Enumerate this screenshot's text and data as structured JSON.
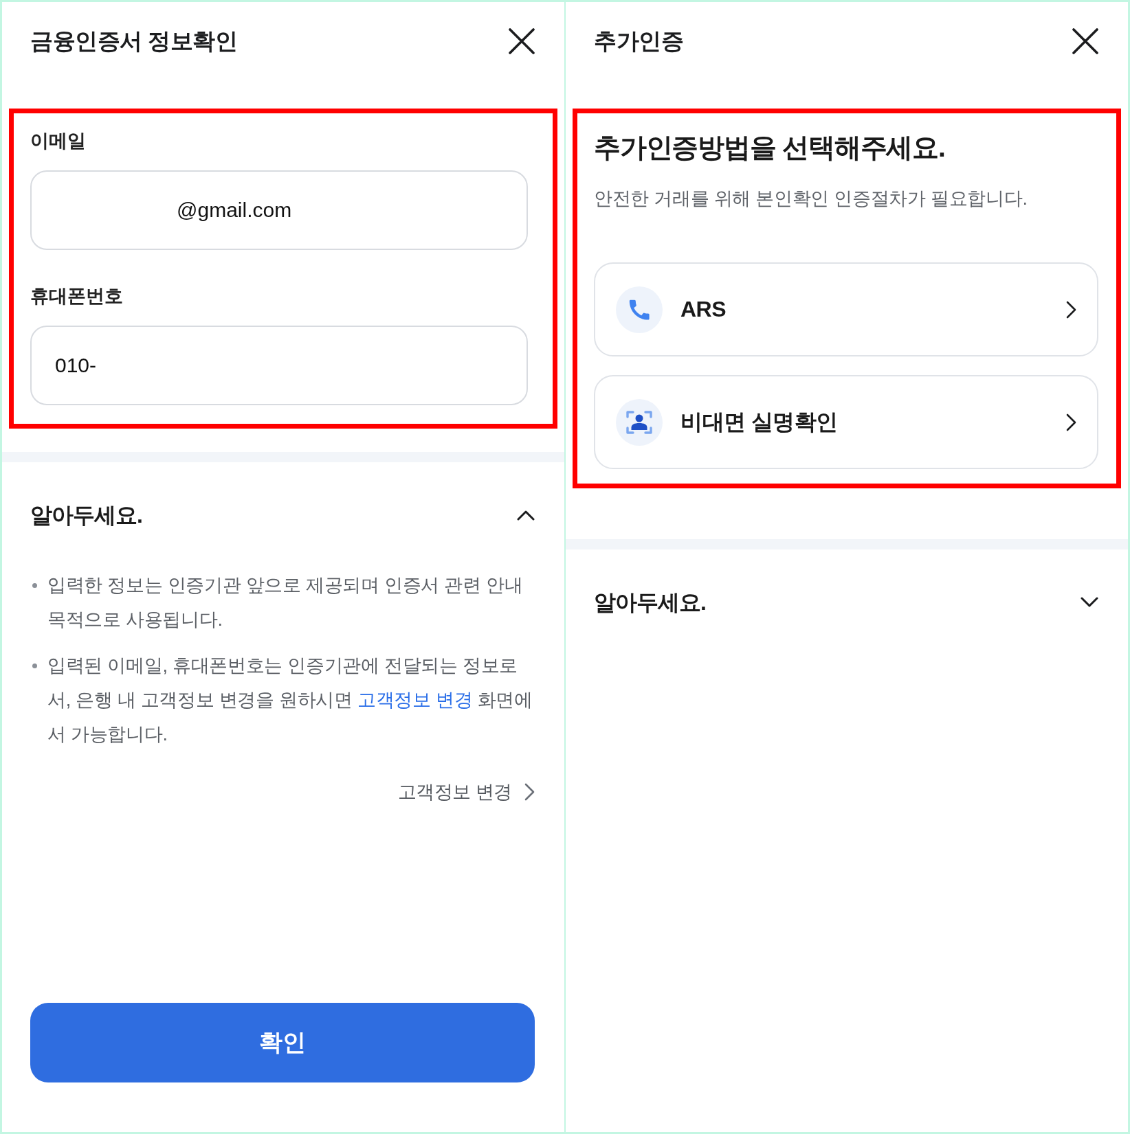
{
  "left_panel": {
    "title": "금융인증서 정보확인",
    "highlighted": true,
    "fields": [
      {
        "label": "이메일",
        "value": "@gmail.com"
      },
      {
        "label": "휴대폰번호",
        "value": "010-"
      }
    ],
    "notice": {
      "title": "알아두세요.",
      "expanded": true,
      "items": [
        {
          "text": "입력한 정보는 인증기관 앞으로 제공되며 인증서 관련 안내 목적으로 사용됩니다."
        },
        {
          "text": "입력된 이메일, 휴대폰번호는 인증기관에 전달되는 정보로서, 은행 내 고객정보 변경을 원하시면 ",
          "link": "고객정보 변경",
          "text_after": " 화면에서 가능합니다."
        }
      ],
      "more_link": "고객정보 변경"
    },
    "confirm_button": "확인"
  },
  "right_panel": {
    "title": "추가인증",
    "highlighted": true,
    "heading": "추가인증방법을 선택해주세요.",
    "description": "안전한 거래를 위해 본인확인 인증절차가 필요합니다.",
    "methods": [
      {
        "kind": "phone",
        "label": "ARS"
      },
      {
        "kind": "identity",
        "label": "비대면 실명확인"
      }
    ],
    "notice": {
      "title": "알아두세요.",
      "expanded": false
    }
  }
}
